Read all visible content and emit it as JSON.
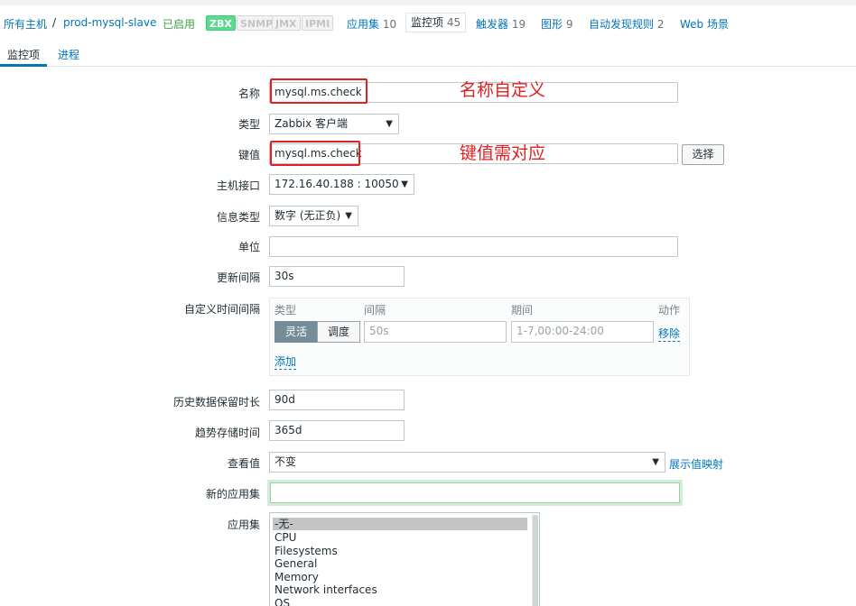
{
  "breadcrumb": {
    "all_hosts": "所有主机",
    "separator": "/",
    "host": "prod-mysql-slave",
    "status": "已启用",
    "availability": [
      "ZBX",
      "SNMP",
      "JMX",
      "IPMI"
    ]
  },
  "host_tabs": [
    {
      "label": "应用集",
      "count": "10"
    },
    {
      "label": "监控项",
      "count": "45"
    },
    {
      "label": "触发器",
      "count": "19"
    },
    {
      "label": "图形",
      "count": "9"
    },
    {
      "label": "自动发现规则",
      "count": "2"
    },
    {
      "label": "Web 场景",
      "count": ""
    }
  ],
  "sub_tabs": [
    "监控项",
    "进程"
  ],
  "form": {
    "name_label": "名称",
    "name_value": "mysql.ms.check",
    "type_label": "类型",
    "type_value": "Zabbix 客户端",
    "key_label": "键值",
    "key_value": "mysql.ms.check",
    "select_button": "选择",
    "interface_label": "主机接口",
    "interface_value": "172.16.40.188 : 10050",
    "info_type_label": "信息类型",
    "info_type_value": "数字 (无正负)",
    "units_label": "单位",
    "units_value": "",
    "update_label": "更新间隔",
    "update_value": "30s",
    "custom_label": "自定义时间间隔",
    "custom": {
      "col_type": "类型",
      "col_interval": "间隔",
      "col_period": "期间",
      "col_action": "动作",
      "flexible": "灵活",
      "scheduling": "调度",
      "interval_placeholder": "50s",
      "period_placeholder": "1-7,00:00-24:00",
      "remove": "移除",
      "add": "添加"
    },
    "history_label": "历史数据保留时长",
    "history_value": "90d",
    "trends_label": "趋势存储时间",
    "trends_value": "365d",
    "valuemap_label": "查看值",
    "valuemap_value": "不变",
    "valuemap_link": "展示值映射",
    "new_app_label": "新的应用集",
    "new_app_value": "",
    "apps_label": "应用集",
    "apps": [
      "-无-",
      "CPU",
      "Filesystems",
      "General",
      "Memory",
      "Network interfaces",
      "OS"
    ]
  },
  "annotations": {
    "name_note": "名称自定义",
    "key_note": "键值需对应"
  },
  "colors": {
    "link": "#0275b8",
    "enabled": "#429e47",
    "zbx_available": "#59db8f",
    "annotation": "#e02020"
  }
}
